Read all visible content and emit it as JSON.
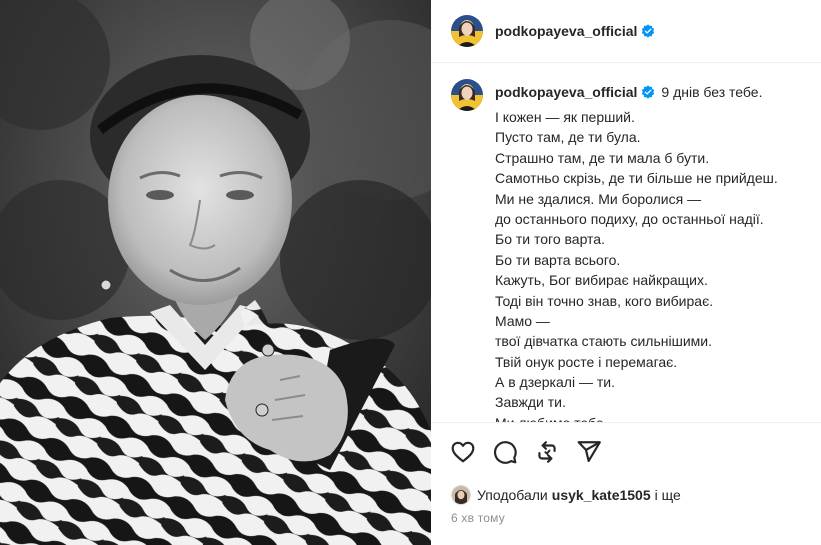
{
  "post": {
    "username": "podkopayeva_official",
    "caption_first_line": "9 днів без тебе.",
    "caption_lines": [
      "І кожен — як перший.",
      "Пусто там, де ти була.",
      "Страшно там, де ти мала б бути.",
      "Самотньо скрізь, де ти більше не прийдеш.",
      "Ми не здалися. Ми боролися —",
      "до останнього подиху, до останньої надії.",
      "Бо ти того варта.",
      "Бо ти варта всього.",
      "Кажуть, Бог вибирає найкращих.",
      "Тоді він точно знав, кого вибирає.",
      "Мамо —",
      "твої дівчатка стають сильнішими.",
      "Твій онук росте і перемагає.",
      "А в дзеркалі — ти.",
      "Завжди ти.",
      "Ми любимо тебе."
    ],
    "likes": {
      "prefix": "Уподобали",
      "user": "usyk_kate1505",
      "suffix": "і ще"
    },
    "time_ago": "6 хв тому"
  },
  "icons": {
    "like": "heart-icon",
    "comment": "comment-icon",
    "repost": "repost-icon",
    "share": "send-icon",
    "verified": "verified-badge-icon"
  },
  "colors": {
    "text": "#262626",
    "muted": "#8e8e8e",
    "verified": "#0095f6",
    "divider": "#efefef"
  }
}
